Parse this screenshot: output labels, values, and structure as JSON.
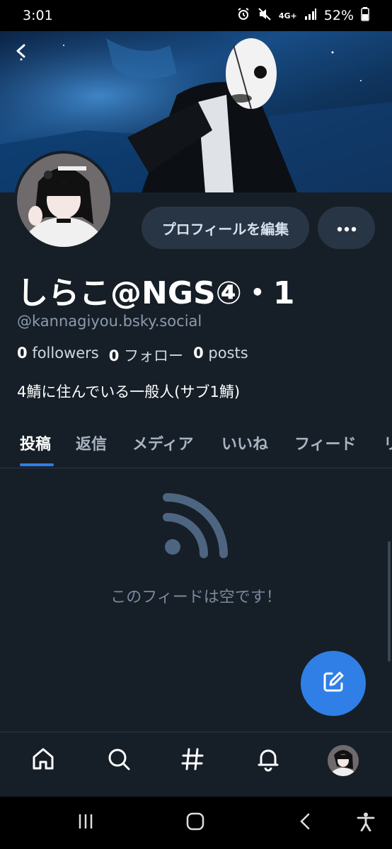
{
  "status_bar": {
    "time": "3:01",
    "network": "4G+",
    "battery": "52%"
  },
  "profile": {
    "display_name": "しらこ@NGS④・1",
    "handle": "@kannagiyou.bsky.social",
    "followers_count": "0",
    "followers_label": "followers",
    "following_count": "0",
    "following_label": "フォロー",
    "posts_count": "0",
    "posts_label": "posts",
    "bio": "4鯖に住んでいる一般人(サブ1鯖)"
  },
  "actions": {
    "edit_profile_label": "プロフィールを編集",
    "more_icon": "ellipsis-icon"
  },
  "tabs": [
    {
      "label": "投稿",
      "active": true
    },
    {
      "label": "返信",
      "active": false
    },
    {
      "label": "メディア",
      "active": false
    },
    {
      "label": "いいね",
      "active": false
    },
    {
      "label": "フィード",
      "active": false
    },
    {
      "label": "リ",
      "active": false
    }
  ],
  "empty_state": {
    "icon": "rss-feed-icon",
    "message": "このフィードは空です！"
  },
  "bottom_nav": [
    {
      "name": "home-icon"
    },
    {
      "name": "search-icon"
    },
    {
      "name": "hashtag-icon"
    },
    {
      "name": "bell-icon"
    },
    {
      "name": "profile-avatar"
    }
  ],
  "colors": {
    "background": "#161e27",
    "accent": "#2f7fe6",
    "button_bg": "#283544",
    "muted_text": "#8c9bab"
  }
}
